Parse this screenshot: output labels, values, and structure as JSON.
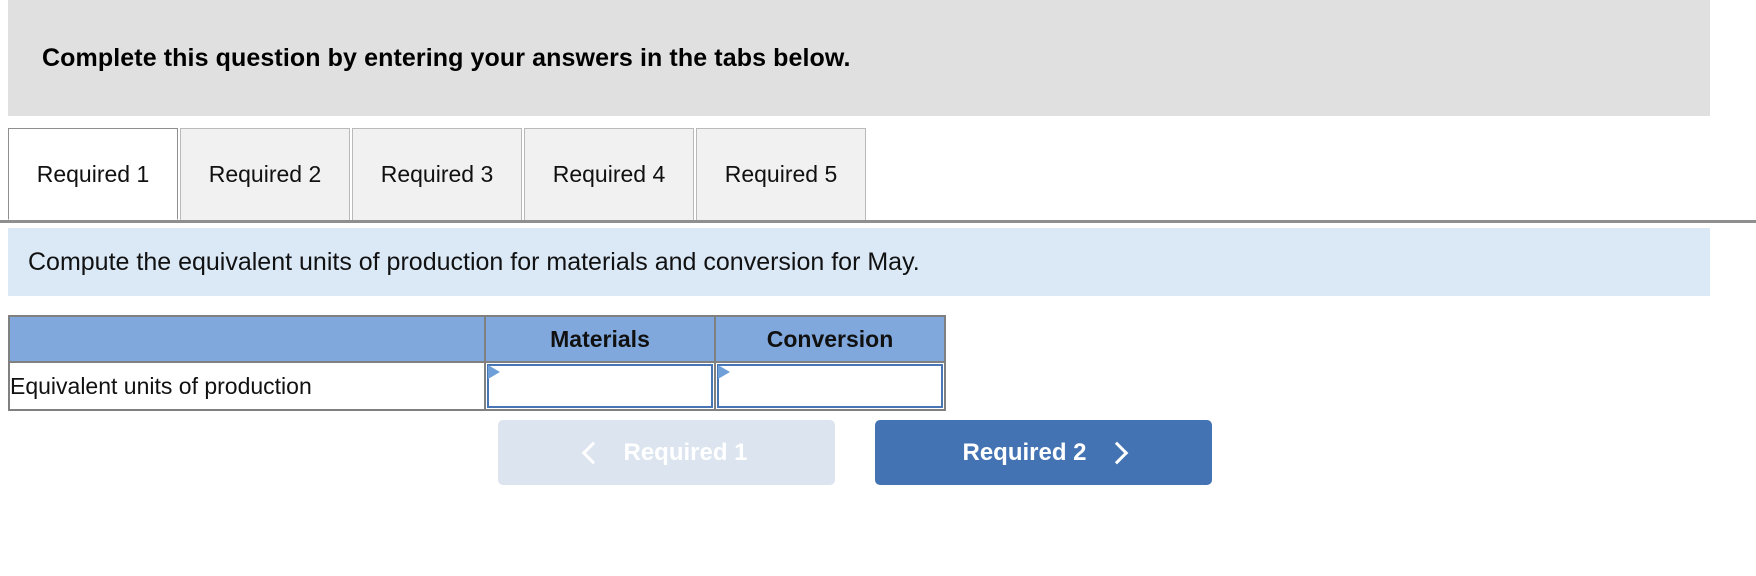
{
  "banner": {
    "text": "Complete this question by entering your answers in the tabs below."
  },
  "tabs": {
    "items": [
      {
        "label": "Required 1",
        "active": true
      },
      {
        "label": "Required 2",
        "active": false
      },
      {
        "label": "Required 3",
        "active": false
      },
      {
        "label": "Required 4",
        "active": false
      },
      {
        "label": "Required 5",
        "active": false
      }
    ]
  },
  "sub_banner": {
    "text": "Compute the equivalent units of production for materials and conversion for May."
  },
  "table": {
    "headers": [
      "",
      "Materials",
      "Conversion"
    ],
    "rows": [
      {
        "label": "Equivalent units of production",
        "materials": "",
        "conversion": ""
      }
    ]
  },
  "nav": {
    "prev_label": "Required 1",
    "next_label": "Required 2",
    "prev_icon": "chevron-left-icon",
    "next_icon": "chevron-right-icon",
    "prev_disabled": true
  },
  "colors": {
    "banner_bg": "#e0e0e0",
    "sub_banner_bg": "#dbe9f7",
    "table_header_bg": "#81a8dd",
    "input_border": "#4876b4",
    "next_button_bg": "#4373b3",
    "prev_button_bg": "#dbe4ef",
    "tab_inactive_bg": "#f1f1f1",
    "tab_active_bg": "#ffffff"
  }
}
